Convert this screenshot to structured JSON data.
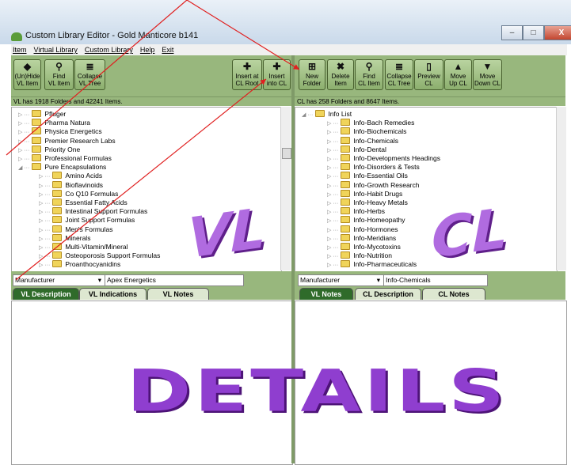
{
  "window": {
    "title": "Custom Library Editor - Gold Manticore b141",
    "controls": [
      "–",
      "□",
      "X"
    ]
  },
  "menu": [
    {
      "label": "Item"
    },
    {
      "label": "Virtual Library"
    },
    {
      "label": "Custom Library"
    },
    {
      "label": "Help"
    },
    {
      "label": "Exit"
    }
  ],
  "vl": {
    "buttons": [
      {
        "label": "(Un)Hide\nVL Item",
        "icon": "diamond-icon"
      },
      {
        "label": "Find\nVL Item",
        "icon": "search-icon"
      },
      {
        "label": "Collapse\nVL Tree",
        "icon": "collapse-icon"
      },
      {
        "label": "Insert at\nCL Root",
        "icon": "plus-icon"
      },
      {
        "label": "Insert\ninto CL",
        "icon": "plus-icon"
      }
    ],
    "status": "VL has 1918 Folders and 42241 Items.",
    "tree": [
      {
        "label": "Pfluger",
        "level": 1
      },
      {
        "label": "Pharma Natura",
        "level": 1
      },
      {
        "label": "Physica Energetics",
        "level": 1
      },
      {
        "label": "Premier Research Labs",
        "level": 1
      },
      {
        "label": "Priority One",
        "level": 1
      },
      {
        "label": "Professional Formulas",
        "level": 1
      },
      {
        "label": "Pure Encapsulations",
        "level": 1,
        "expanded": true
      },
      {
        "label": "Amino Acids",
        "level": 2
      },
      {
        "label": "Bioflavinoids",
        "level": 2
      },
      {
        "label": "Co Q10 Formulas",
        "level": 2
      },
      {
        "label": "Essential Fatty Acids",
        "level": 2
      },
      {
        "label": "Intestinal Support Formulas",
        "level": 2
      },
      {
        "label": "Joint Support Formulas",
        "level": 2
      },
      {
        "label": "Men's Formulas",
        "level": 2
      },
      {
        "label": "Minerals",
        "level": 2
      },
      {
        "label": "Multi-Vitamin/Mineral",
        "level": 2
      },
      {
        "label": "Osteoporosis Support Formulas",
        "level": 2
      },
      {
        "label": "Proanthocyanidins",
        "level": 2
      }
    ],
    "logo": "VL",
    "filter_field": "Manufacturer",
    "filter_value": "Apex Energetics",
    "tabs": [
      "VL Description",
      "VL Indications",
      "VL Notes"
    ]
  },
  "cl": {
    "buttons": [
      {
        "label": "New\nFolder",
        "icon": "new-folder-icon"
      },
      {
        "label": "Delete\nItem",
        "icon": "delete-icon"
      },
      {
        "label": "Find\nCL Item",
        "icon": "search-icon"
      },
      {
        "label": "Collapse\nCL Tree",
        "icon": "collapse-icon"
      },
      {
        "label": "Preview\nCL",
        "icon": "document-icon"
      },
      {
        "label": "Move\nUp CL",
        "icon": "up-arrow-icon"
      },
      {
        "label": "Move\nDown CL",
        "icon": "down-arrow-icon"
      }
    ],
    "status": "CL has 258 Folders and 8647 Items.",
    "tree": [
      {
        "label": "Info List",
        "level": 1,
        "expanded": true
      },
      {
        "label": "Info-Bach Remedies",
        "level": 2
      },
      {
        "label": "Info-Biochemicals",
        "level": 2
      },
      {
        "label": "Info-Chemicals",
        "level": 2
      },
      {
        "label": "Info-Dental",
        "level": 2
      },
      {
        "label": "Info-Developments Headings",
        "level": 2
      },
      {
        "label": "Info-Disorders & Tests",
        "level": 2
      },
      {
        "label": "Info-Essential Oils",
        "level": 2
      },
      {
        "label": "Info-Growth Research",
        "level": 2
      },
      {
        "label": "Info-Habit Drugs",
        "level": 2
      },
      {
        "label": "Info-Heavy Metals",
        "level": 2
      },
      {
        "label": "Info-Herbs",
        "level": 2
      },
      {
        "label": "Info-Homeopathy",
        "level": 2
      },
      {
        "label": "Info-Hormones",
        "level": 2
      },
      {
        "label": "Info-Meridians",
        "level": 2
      },
      {
        "label": "Info-Mycotoxins",
        "level": 2
      },
      {
        "label": "Info-Nutrition",
        "level": 2
      },
      {
        "label": "Info-Pharmaceuticals",
        "level": 2
      }
    ],
    "logo": "CL",
    "filter_field": "Manufacturer",
    "filter_value": "Info-Chemicals",
    "tabs": [
      "VL Notes",
      "CL Description",
      "CL Notes"
    ]
  },
  "details_label": "DETAILS",
  "colors": {
    "pane_green": "#98b77d",
    "active_tab": "#2f6b2a",
    "logo_purple": "#9b4fd6",
    "arrow_red": "#e02020"
  }
}
